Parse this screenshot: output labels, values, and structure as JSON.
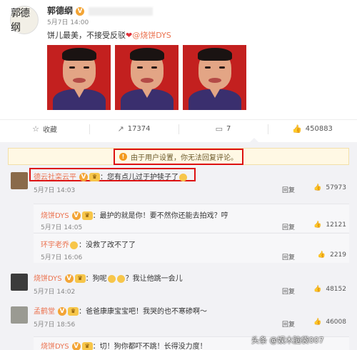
{
  "post": {
    "avatar_text": "郭德纲",
    "username": "郭德纲",
    "level": "V",
    "meta": "5月7日 14:00",
    "text_before": "饼儿最美，不接受反驳",
    "heart": "❤",
    "mention": "@烧饼DYS"
  },
  "actions": {
    "favorite": "收藏",
    "repost": "17374",
    "comments": "7",
    "likes": "450883"
  },
  "notice": "由于用户设置，你无法回复评论。",
  "reply_label": "回复",
  "comments": [
    {
      "name": "德云社栾云平",
      "text": "：您有点儿过于护犊子了",
      "time": "5月7日 14:03",
      "likes": "57973"
    },
    {
      "name": "烧饼DYS",
      "text": "：最护的就是你！要不然你还能去拍戏？哼",
      "time": "5月7日 14:05",
      "likes": "12121"
    },
    {
      "name": "环宇老乔",
      "text": "：没救了改不了了",
      "time": "5月7日 16:06",
      "likes": "2219"
    },
    {
      "name": "烧饼DYS",
      "text": "：狗呢",
      "text2": "？我让他跳一会儿",
      "time": "5月7日 14:02",
      "likes": "48152"
    },
    {
      "name": "孟鹤堂",
      "text": "：爸爸康康宝宝吧！我哭的也不寒碜啊～",
      "time": "5月7日 18:56",
      "likes": "46008"
    },
    {
      "name": "烧饼DYS",
      "text": "：切！狗你都吓不跳！长得没力度！"
    }
  ],
  "watermark": "头条 @娱木脑袋007"
}
